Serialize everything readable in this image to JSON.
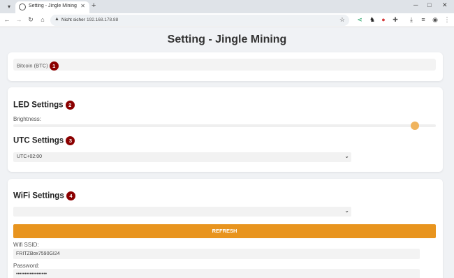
{
  "browser": {
    "tab_title": "Setting - Jingle Mining",
    "tab_list_icon": "chevron-down-icon",
    "new_tab_label": "+",
    "security_label": "Nicht sicher",
    "url": "192.168.178.88"
  },
  "page": {
    "title": "Setting - Jingle Mining",
    "coin": {
      "value": "Bitcoin (BTC)",
      "badge": "1"
    },
    "led": {
      "heading": "LED Settings",
      "badge": "2",
      "brightness_label": "Brightness:",
      "brightness_fraction": 0.96
    },
    "utc": {
      "heading": "UTC Settings",
      "badge": "3",
      "selected": "UTC+02:00"
    },
    "wifi": {
      "heading": "WiFi Settings",
      "badge": "4",
      "network_selected": "",
      "refresh_label": "REFRESH",
      "ssid_label": "Wifi SSID:",
      "ssid_value": "FRITZBox7590GI24",
      "password_label": "Password:",
      "password_value": "••••••••••••••••••"
    }
  },
  "colors": {
    "accent": "#e8941e",
    "badge": "#8b0000",
    "slider_thumb": "#f0b45e"
  }
}
